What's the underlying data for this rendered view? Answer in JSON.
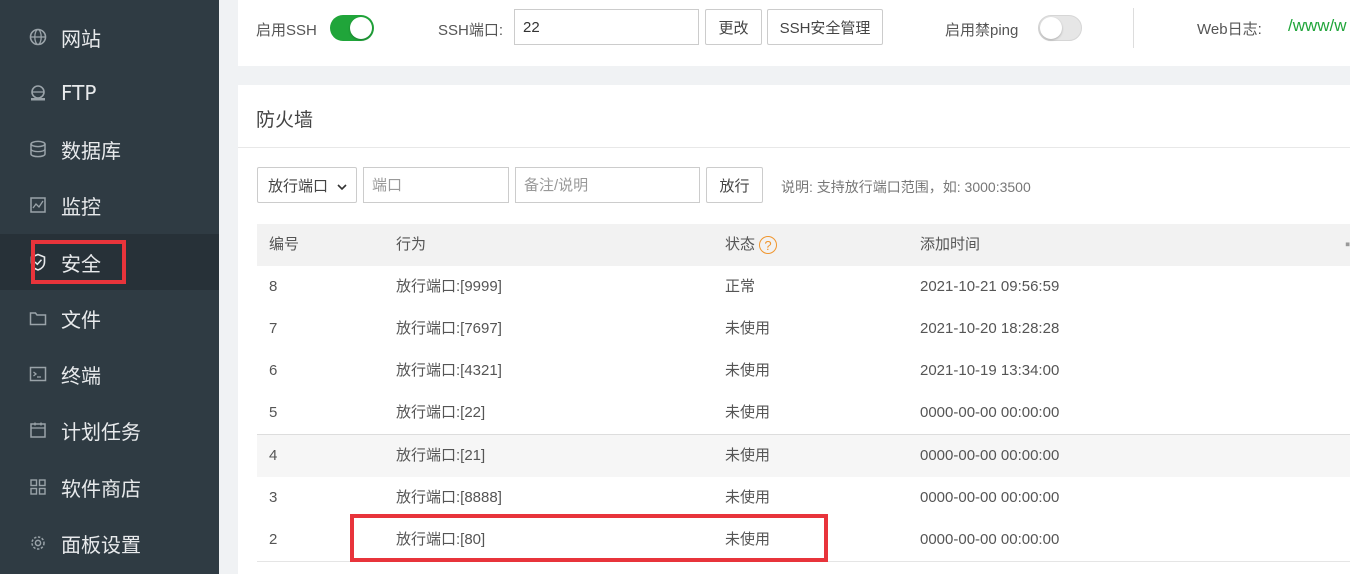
{
  "sidebar": {
    "items": [
      {
        "label": "网站",
        "icon": "globe-icon"
      },
      {
        "label": "FTP",
        "icon": "ftp-icon"
      },
      {
        "label": "数据库",
        "icon": "database-icon"
      },
      {
        "label": "监控",
        "icon": "monitor-icon"
      },
      {
        "label": "安全",
        "icon": "shield-icon",
        "active": true
      },
      {
        "label": "文件",
        "icon": "folder-icon"
      },
      {
        "label": "终端",
        "icon": "terminal-icon"
      },
      {
        "label": "计划任务",
        "icon": "calendar-icon"
      },
      {
        "label": "软件商店",
        "icon": "grid-icon"
      },
      {
        "label": "面板设置",
        "icon": "gear-icon"
      }
    ]
  },
  "top": {
    "ssh_enable_label": "启用SSH",
    "ssh_enabled": true,
    "ssh_port_label": "SSH端口:",
    "ssh_port_value": "22",
    "change_button": "更改",
    "ssh_manage_button": "SSH安全管理",
    "ping_label": "启用禁ping",
    "ping_enabled": false,
    "web_log_label": "Web日志:",
    "web_log_path": "/www/w"
  },
  "firewall": {
    "title": "防火墙",
    "select_value": "放行端口",
    "port_placeholder": "端口",
    "note_placeholder": "备注/说明",
    "allow_button": "放行",
    "hint": "说明: 支持放行端口范围，如: 3000:3500",
    "columns": {
      "id": "编号",
      "action": "行为",
      "status": "状态",
      "status_help": "?",
      "time": "添加时间"
    },
    "rows": [
      {
        "id": "8",
        "action": "放行端口:[9999]",
        "status": "正常",
        "time": "2021-10-21 09:56:59"
      },
      {
        "id": "7",
        "action": "放行端口:[7697]",
        "status": "未使用",
        "time": "2021-10-20 18:28:28"
      },
      {
        "id": "6",
        "action": "放行端口:[4321]",
        "status": "未使用",
        "time": "2021-10-19 13:34:00"
      },
      {
        "id": "5",
        "action": "放行端口:[22]",
        "status": "未使用",
        "time": "0000-00-00 00:00:00"
      },
      {
        "id": "4",
        "action": "放行端口:[21]",
        "status": "未使用",
        "time": "0000-00-00 00:00:00"
      },
      {
        "id": "3",
        "action": "放行端口:[8888]",
        "status": "未使用",
        "time": "0000-00-00 00:00:00"
      },
      {
        "id": "2",
        "action": "放行端口:[80]",
        "status": "未使用",
        "time": "0000-00-00 00:00:00"
      }
    ]
  },
  "colors": {
    "sidebar_bg": "#2f3b43",
    "accent_green": "#20a53a",
    "highlight_red": "#e8343b",
    "help_orange": "#f0962e"
  }
}
